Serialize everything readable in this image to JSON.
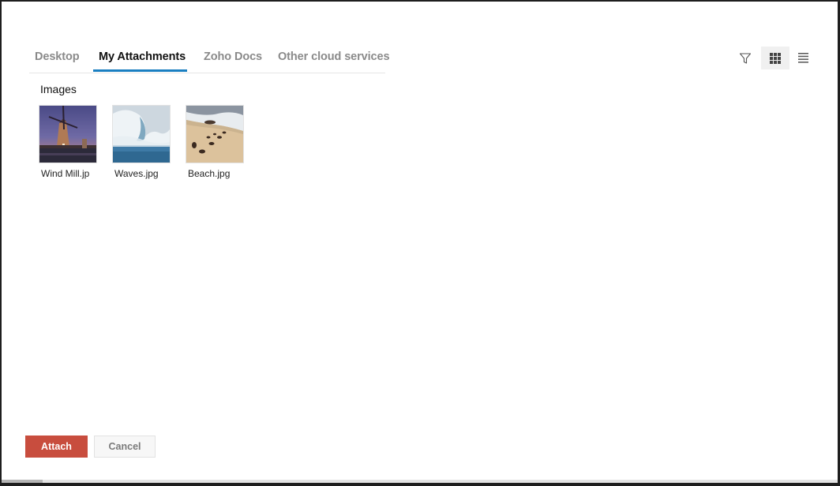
{
  "tabs": [
    {
      "label": "Desktop",
      "active": false
    },
    {
      "label": "My Attachments",
      "active": true
    },
    {
      "label": "Zoho Docs",
      "active": false
    },
    {
      "label": "Other cloud services",
      "active": false
    }
  ],
  "toolbar": {
    "filter_icon": "filter-icon",
    "grid_view_icon": "grid-icon",
    "list_view_icon": "list-icon",
    "active_view": "grid"
  },
  "section": {
    "title": "Images"
  },
  "files": [
    {
      "name": "Wind Mill.jpg",
      "display_name": "Wind Mill.jp",
      "thumbnail": "windmill-at-dusk"
    },
    {
      "name": "Waves.jpg",
      "display_name": "Waves.jpg",
      "thumbnail": "ocean-wave"
    },
    {
      "name": "Beach.jpg",
      "display_name": "Beach.jpg",
      "thumbnail": "footprints-on-beach"
    }
  ],
  "actions": {
    "attach_label": "Attach",
    "cancel_label": "Cancel"
  },
  "colors": {
    "accent_tab": "#1a7fc1",
    "attach_button": "#c84d3e"
  }
}
